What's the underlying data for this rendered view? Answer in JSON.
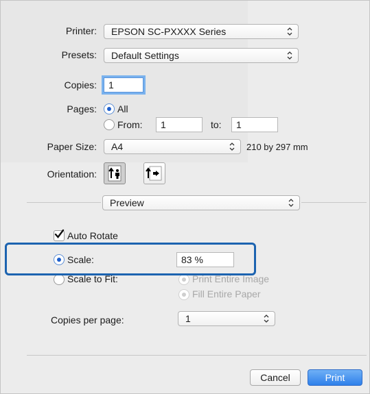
{
  "printer": {
    "label": "Printer:",
    "value": "EPSON SC-PXXXX Series"
  },
  "presets": {
    "label": "Presets:",
    "value": "Default Settings"
  },
  "copies": {
    "label": "Copies:",
    "value": "1"
  },
  "pages": {
    "label": "Pages:",
    "all_label": "All",
    "from_label": "From:",
    "from_value": "1",
    "to_label": "to:",
    "to_value": "1"
  },
  "paper_size": {
    "label": "Paper Size:",
    "value": "A4",
    "dimensions": "210 by 297 mm"
  },
  "orientation": {
    "label": "Orientation:",
    "options": [
      "portrait",
      "landscape"
    ],
    "selected": "portrait"
  },
  "panel": {
    "value": "Preview"
  },
  "auto_rotate": {
    "label": "Auto Rotate",
    "checked": true
  },
  "scale": {
    "label": "Scale:",
    "value": "83 %",
    "selected": true
  },
  "scale_to_fit": {
    "label": "Scale to Fit:",
    "print_entire_image": "Print Entire Image",
    "fill_entire_paper": "Fill Entire Paper"
  },
  "copies_per_page": {
    "label": "Copies per page:",
    "value": "1"
  },
  "buttons": {
    "cancel": "Cancel",
    "print": "Print"
  },
  "colors": {
    "accent": "#2f80ea",
    "highlight": "#1c63b0"
  }
}
